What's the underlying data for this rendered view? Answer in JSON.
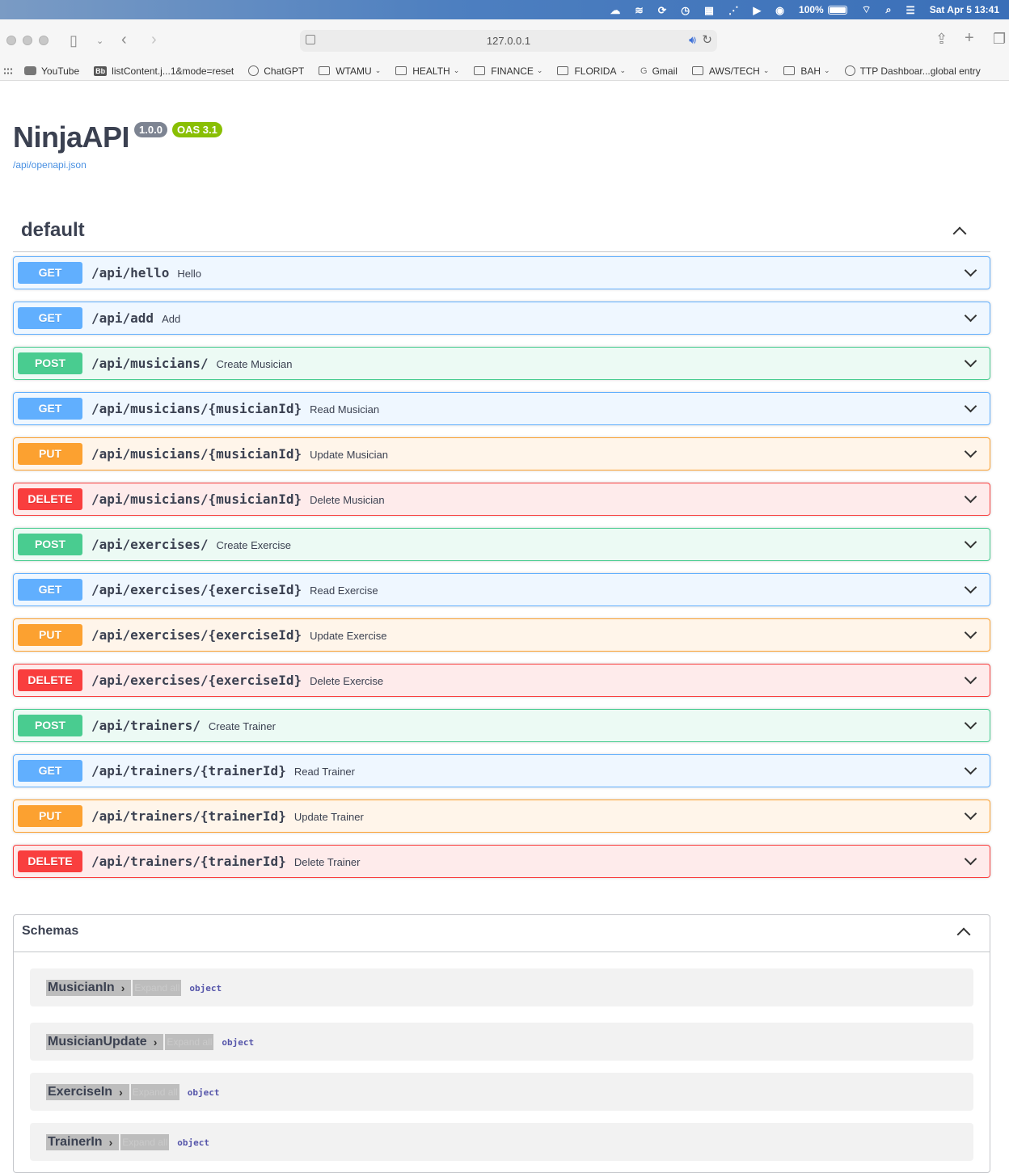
{
  "menubar": {
    "battery_pct": "100%",
    "datetime": "Sat Apr 5  13:41"
  },
  "browser": {
    "url": "127.0.0.1",
    "bookmarks": [
      {
        "label": "YouTube",
        "icon": "youtube-icon"
      },
      {
        "label": "listContent.j...1&mode=reset",
        "icon": "blackboard-icon"
      },
      {
        "label": "ChatGPT",
        "icon": "chatgpt-icon"
      },
      {
        "label": "WTAMU",
        "icon": "folder-icon",
        "folder": true
      },
      {
        "label": "HEALTH",
        "icon": "folder-icon",
        "folder": true
      },
      {
        "label": "FINANCE",
        "icon": "folder-icon",
        "folder": true
      },
      {
        "label": "FLORIDA",
        "icon": "folder-icon",
        "folder": true
      },
      {
        "label": "Gmail",
        "icon": "google-icon"
      },
      {
        "label": "AWS/TECH",
        "icon": "folder-icon",
        "folder": true
      },
      {
        "label": "BAH",
        "icon": "folder-icon",
        "folder": true
      },
      {
        "label": "TTP Dashboar...global entry",
        "icon": "seal-icon"
      }
    ]
  },
  "info": {
    "title": "NinjaAPI",
    "version": "1.0.0",
    "oas": "OAS 3.1",
    "spec_link": "/api/openapi.json"
  },
  "tag": {
    "name": "default"
  },
  "operations": [
    {
      "method": "GET",
      "path": "/api/hello",
      "summary": "Hello"
    },
    {
      "method": "GET",
      "path": "/api/add",
      "summary": "Add"
    },
    {
      "method": "POST",
      "path": "/api/musicians/",
      "summary": "Create Musician"
    },
    {
      "method": "GET",
      "path": "/api/musicians/{musicianId}",
      "summary": "Read Musician"
    },
    {
      "method": "PUT",
      "path": "/api/musicians/{musicianId}",
      "summary": "Update Musician"
    },
    {
      "method": "DELETE",
      "path": "/api/musicians/{musicianId}",
      "summary": "Delete Musician"
    },
    {
      "method": "POST",
      "path": "/api/exercises/",
      "summary": "Create Exercise"
    },
    {
      "method": "GET",
      "path": "/api/exercises/{exerciseId}",
      "summary": "Read Exercise"
    },
    {
      "method": "PUT",
      "path": "/api/exercises/{exerciseId}",
      "summary": "Update Exercise"
    },
    {
      "method": "DELETE",
      "path": "/api/exercises/{exerciseId}",
      "summary": "Delete Exercise"
    },
    {
      "method": "POST",
      "path": "/api/trainers/",
      "summary": "Create Trainer"
    },
    {
      "method": "GET",
      "path": "/api/trainers/{trainerId}",
      "summary": "Read Trainer"
    },
    {
      "method": "PUT",
      "path": "/api/trainers/{trainerId}",
      "summary": "Update Trainer"
    },
    {
      "method": "DELETE",
      "path": "/api/trainers/{trainerId}",
      "summary": "Delete Trainer"
    }
  ],
  "schemas": {
    "title": "Schemas",
    "expand_all_label": "Expand all",
    "models": [
      {
        "name": "MusicianIn",
        "type": "object"
      },
      {
        "name": "MusicianUpdate",
        "type": "object"
      },
      {
        "name": "ExerciseIn",
        "type": "object"
      },
      {
        "name": "TrainerIn",
        "type": "object"
      }
    ]
  },
  "colors": {
    "get": "#61affe",
    "post": "#49cc90",
    "put": "#fca130",
    "delete": "#f93e3e",
    "version_badge": "#7d8492",
    "oas_badge": "#89bf04"
  }
}
